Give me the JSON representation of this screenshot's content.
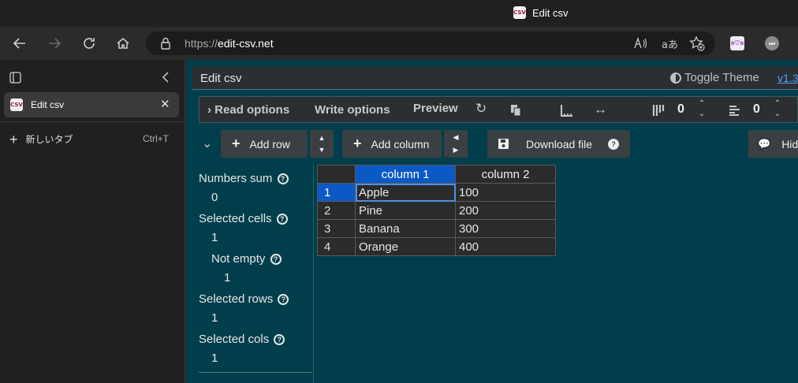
{
  "window": {
    "title": "Edit csv",
    "favicon_text": "CSV"
  },
  "browser": {
    "url_protocol": "https://",
    "url_host": "edit-csv.net",
    "back_icon": "arrow-left-icon",
    "forward_icon": "arrow-right-icon",
    "refresh_icon": "refresh-icon",
    "home_icon": "home-icon"
  },
  "sidebar": {
    "tab_label": "Edit csv",
    "new_tab_label": "新しいタブ",
    "new_tab_shortcut": "Ctrl+T"
  },
  "app": {
    "title": "Edit csv",
    "toggle_theme": "Toggle Theme",
    "version": "v1.3"
  },
  "options": {
    "read_options": "Read options",
    "write_options": "Write options",
    "preview": "Preview",
    "fixed_rows": "0",
    "fixed_cols": "0"
  },
  "actions": {
    "add_row": "Add row",
    "add_column": "Add column",
    "download_file": "Download file",
    "hide": "Hid"
  },
  "stats": {
    "numbers_sum_label": "Numbers sum",
    "numbers_sum": "0",
    "selected_cells_label": "Selected cells",
    "selected_cells": "1",
    "not_empty_label": "Not empty",
    "not_empty": "1",
    "selected_rows_label": "Selected rows",
    "selected_rows": "1",
    "selected_cols_label": "Selected cols",
    "selected_cols": "1"
  },
  "table": {
    "headers": [
      "column 1",
      "column 2"
    ],
    "rows": [
      {
        "num": "1",
        "c1": "Apple",
        "c2": "100"
      },
      {
        "num": "2",
        "c1": "Pine",
        "c2": "200"
      },
      {
        "num": "3",
        "c1": "Banana",
        "c2": "300"
      },
      {
        "num": "4",
        "c1": "Orange",
        "c2": "400"
      }
    ]
  },
  "colors": {
    "content_bg": "#003e4c",
    "selection": "#0b59c4",
    "accent_link": "#4ea1ff"
  }
}
